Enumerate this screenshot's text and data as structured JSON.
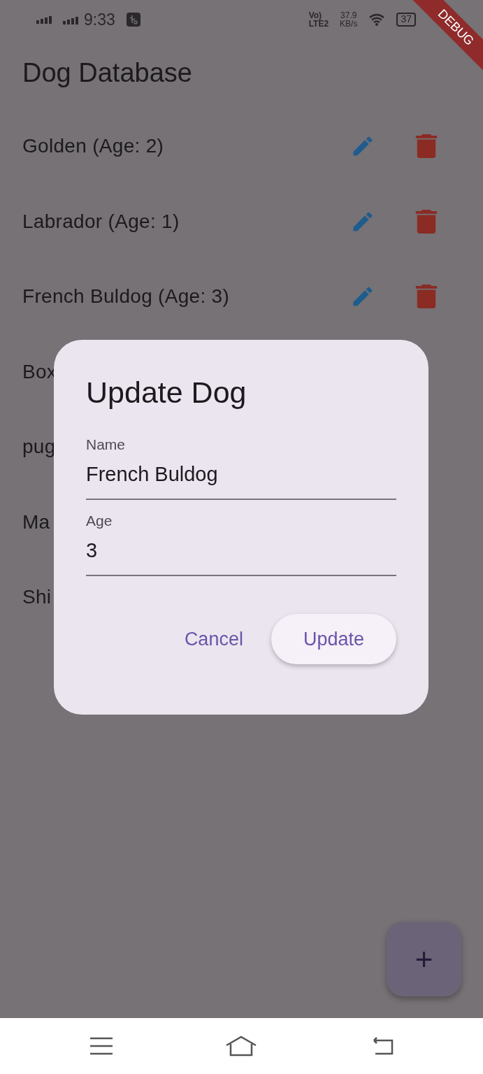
{
  "status_bar": {
    "time": "9:33",
    "volte": "Vo)",
    "lte": "LTE2",
    "speed": "37.9",
    "speed_unit": "KB/s",
    "battery": "37"
  },
  "debug_banner": "DEBUG",
  "app_bar": {
    "title": "Dog Database"
  },
  "dogs": [
    {
      "label": "Golden (Age: 2)",
      "kind": "full"
    },
    {
      "label": "Labrador (Age: 1)",
      "kind": "full"
    },
    {
      "label": "French Buldog (Age: 3)",
      "kind": "full"
    },
    {
      "label": "Box",
      "kind": "covered"
    },
    {
      "label": "pug",
      "kind": "covered"
    },
    {
      "label": "Ma",
      "kind": "covered"
    },
    {
      "label": "Shi",
      "kind": "covered"
    }
  ],
  "dialog": {
    "title": "Update Dog",
    "fields": [
      {
        "label": "Name",
        "value": "French Buldog"
      },
      {
        "label": "Age",
        "value": "3"
      }
    ],
    "buttons": [
      {
        "label": "Cancel",
        "kind": "text"
      },
      {
        "label": "Update",
        "kind": "tonal"
      }
    ]
  },
  "fab": {
    "label": "+"
  }
}
